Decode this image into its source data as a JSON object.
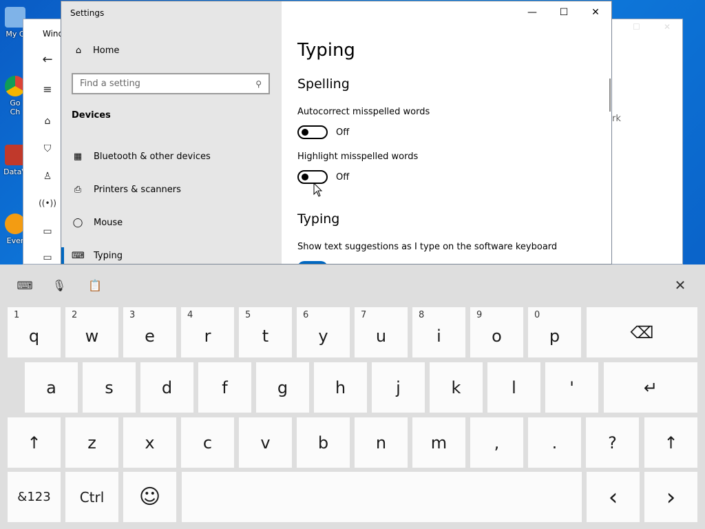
{
  "desktop": {
    "icons": [
      {
        "label": "My C"
      },
      {
        "label": "Go",
        "label2": "Ch"
      },
      {
        "label": "DataV"
      },
      {
        "label": "Ever"
      }
    ]
  },
  "background_window": {
    "title": "Wind",
    "fragment": "rk"
  },
  "settings": {
    "window_title": "Settings",
    "home_label": "Home",
    "search_placeholder": "Find a setting",
    "section": "Devices",
    "nav_items": [
      {
        "label": "Bluetooth & other devices",
        "icon": "bluetooth-devices-icon"
      },
      {
        "label": "Printers & scanners",
        "icon": "printer-icon"
      },
      {
        "label": "Mouse",
        "icon": "mouse-icon"
      },
      {
        "label": "Typing",
        "icon": "keyboard-icon"
      }
    ],
    "page_title": "Typing",
    "spelling_heading": "Spelling",
    "autocorrect_label": "Autocorrect misspelled words",
    "autocorrect_state": "Off",
    "highlight_label": "Highlight misspelled words",
    "highlight_state": "Off",
    "typing_heading": "Typing",
    "suggestions_label": "Show text suggestions as I type on the software keyboard"
  },
  "keyboard": {
    "row1": [
      {
        "num": "1",
        "ch": "q"
      },
      {
        "num": "2",
        "ch": "w"
      },
      {
        "num": "3",
        "ch": "e"
      },
      {
        "num": "4",
        "ch": "r"
      },
      {
        "num": "5",
        "ch": "t"
      },
      {
        "num": "6",
        "ch": "y"
      },
      {
        "num": "7",
        "ch": "u"
      },
      {
        "num": "8",
        "ch": "i"
      },
      {
        "num": "9",
        "ch": "o"
      },
      {
        "num": "0",
        "ch": "p"
      }
    ],
    "row2": [
      "a",
      "s",
      "d",
      "f",
      "g",
      "h",
      "j",
      "k",
      "l",
      "'"
    ],
    "row3": [
      "z",
      "x",
      "c",
      "v",
      "b",
      "n",
      "m",
      ",",
      ".",
      "?"
    ],
    "symbols_label": "&123",
    "ctrl_label": "Ctrl",
    "backspace_glyph": "⌫",
    "enter_glyph": "↵",
    "shift_glyph": "↑",
    "left_glyph": "‹",
    "right_glyph": "›",
    "emoji_glyph": "☺",
    "close_glyph": "✕"
  }
}
